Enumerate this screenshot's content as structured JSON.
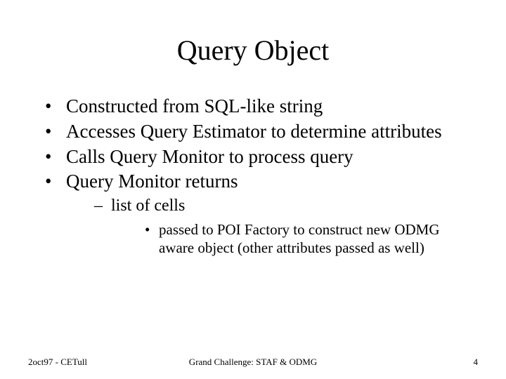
{
  "title": "Query Object",
  "bullets": {
    "b1": "Constructed from SQL-like string",
    "b2": "Accesses Query Estimator to determine attributes",
    "b3": "Calls Query Monitor to process query",
    "b4": "Query Monitor returns",
    "b4_sub1": "list of cells",
    "b4_sub1_sub1": "passed to POI Factory to construct new ODMG aware object (other attributes passed as well)"
  },
  "footer": {
    "left": "2oct97 - CETull",
    "center": "Grand Challenge: STAF & ODMG",
    "right": "4"
  }
}
